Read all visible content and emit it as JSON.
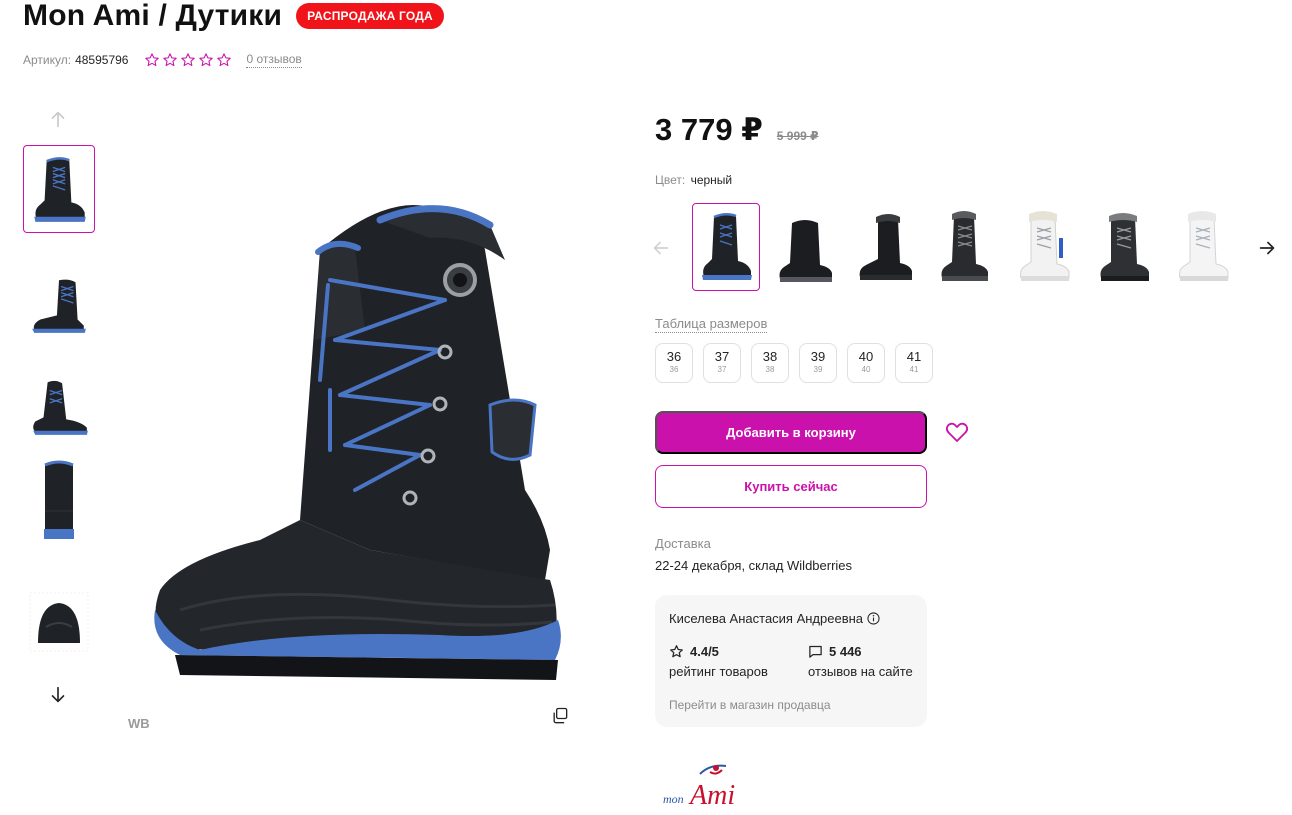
{
  "header": {
    "title": "Mon Ami / Дутики",
    "badge": "РАСПРОДАЖА ГОДА"
  },
  "meta": {
    "sku_label": "Артикул:",
    "sku_value": "48595796",
    "rating_stars": 0,
    "reviews_link": "0 отзывов"
  },
  "gallery": {
    "thumbnails": 5,
    "active_index": 0,
    "watermark": "WB"
  },
  "price": {
    "current": "3 779 ₽",
    "old": "5 999 ₽"
  },
  "color": {
    "label": "Цвет:",
    "value": "черный",
    "swatch_count": 7,
    "active_index": 0
  },
  "sizes": {
    "table_link": "Таблица размеров",
    "items": [
      {
        "size": "36",
        "ru": "36"
      },
      {
        "size": "37",
        "ru": "37"
      },
      {
        "size": "38",
        "ru": "38"
      },
      {
        "size": "39",
        "ru": "39"
      },
      {
        "size": "40",
        "ru": "40"
      },
      {
        "size": "41",
        "ru": "41"
      }
    ]
  },
  "actions": {
    "add_to_cart": "Добавить в корзину",
    "buy_now": "Купить сейчас"
  },
  "delivery": {
    "label": "Доставка",
    "value": "22-24 декабря, склад Wildberries"
  },
  "seller": {
    "name": "Киселева Анастасия Андреевна",
    "rating_value": "4.4/5",
    "rating_label": "рейтинг товаров",
    "reviews_value": "5 446",
    "reviews_label": "отзывов на сайте",
    "link": "Перейти в магазин продавца"
  },
  "brand": {
    "logo_small": "mon",
    "logo_big": "Ami"
  },
  "colors": {
    "accent": "#cb11ab",
    "sale": "#f0131a",
    "muted": "#8b8b8b",
    "boot_black": "#1f2226",
    "boot_blue": "#4a74c4"
  }
}
